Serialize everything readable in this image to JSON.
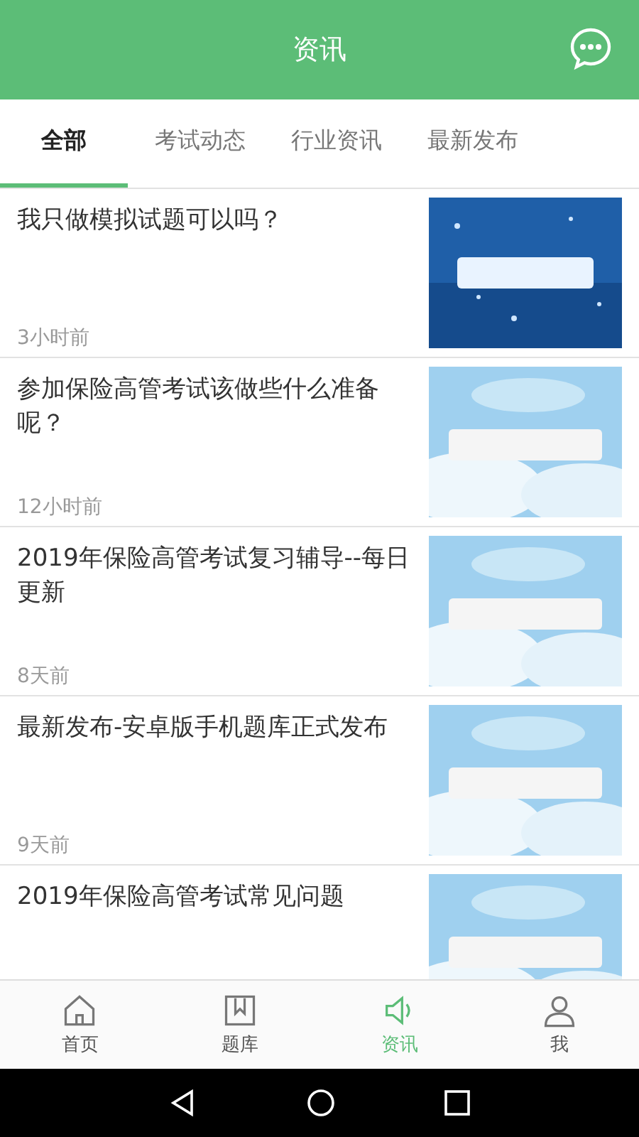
{
  "header": {
    "title": "资讯"
  },
  "tabs": [
    {
      "label": "全部",
      "selected": true
    },
    {
      "label": "考试动态",
      "selected": false
    },
    {
      "label": "行业资讯",
      "selected": false
    },
    {
      "label": "最新发布",
      "selected": false
    }
  ],
  "articles": [
    {
      "title": "我只做模拟试题可以吗？",
      "time": "3小时前"
    },
    {
      "title": "参加保险高管考试该做些什么准备呢？",
      "time": "12小时前"
    },
    {
      "title": "2019年保险高管考试复习辅导--每日更新",
      "time": "8天前"
    },
    {
      "title": "最新发布-安卓版手机题库正式发布",
      "time": "9天前"
    },
    {
      "title": "2019年保险高管考试常见问题"
    }
  ],
  "bottom_nav": [
    {
      "label": "首页",
      "kind": "home",
      "selected": false
    },
    {
      "label": "题库",
      "kind": "bank",
      "selected": false
    },
    {
      "label": "资讯",
      "kind": "news",
      "selected": true
    },
    {
      "label": "我",
      "kind": "me",
      "selected": false
    }
  ]
}
